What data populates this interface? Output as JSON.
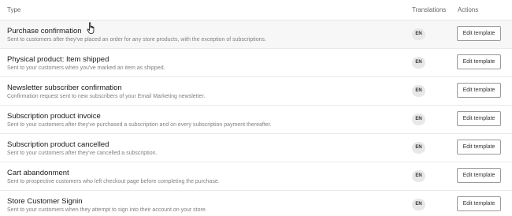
{
  "header": {
    "type": "Type",
    "translations": "Translations",
    "actions": "Actions"
  },
  "rows": [
    {
      "title": "Purchase confirmation",
      "description": "Sent to customers after they've placed an order for any store products, with the exception of subscriptions.",
      "language": "EN",
      "action": "Edit template"
    },
    {
      "title": "Physical product: Item shipped",
      "description": "Sent to your customers when you've marked an item as shipped.",
      "language": "EN",
      "action": "Edit template"
    },
    {
      "title": "Newsletter subscriber confirmation",
      "description": "Confirmation request sent to new subscribers of your Email Marketing newsletter.",
      "language": "EN",
      "action": "Edit template"
    },
    {
      "title": "Subscription product invoice",
      "description": "Sent to your customers after they've purchased a subscription and on every subscription payment thereafter.",
      "language": "EN",
      "action": "Edit template"
    },
    {
      "title": "Subscription product cancelled",
      "description": "Sent to your customers after they've cancelled a subscription.",
      "language": "EN",
      "action": "Edit template"
    },
    {
      "title": "Cart abandonment",
      "description": "Sent to prospective customers who left checkout page before completing the purchase.",
      "language": "EN",
      "action": "Edit template"
    },
    {
      "title": "Store Customer Signin",
      "description": "Sent to your customers when they attempt to sign into their account on your store.",
      "language": "EN",
      "action": "Edit template"
    }
  ],
  "icons": {
    "cursor": "hand-pointer-icon"
  }
}
